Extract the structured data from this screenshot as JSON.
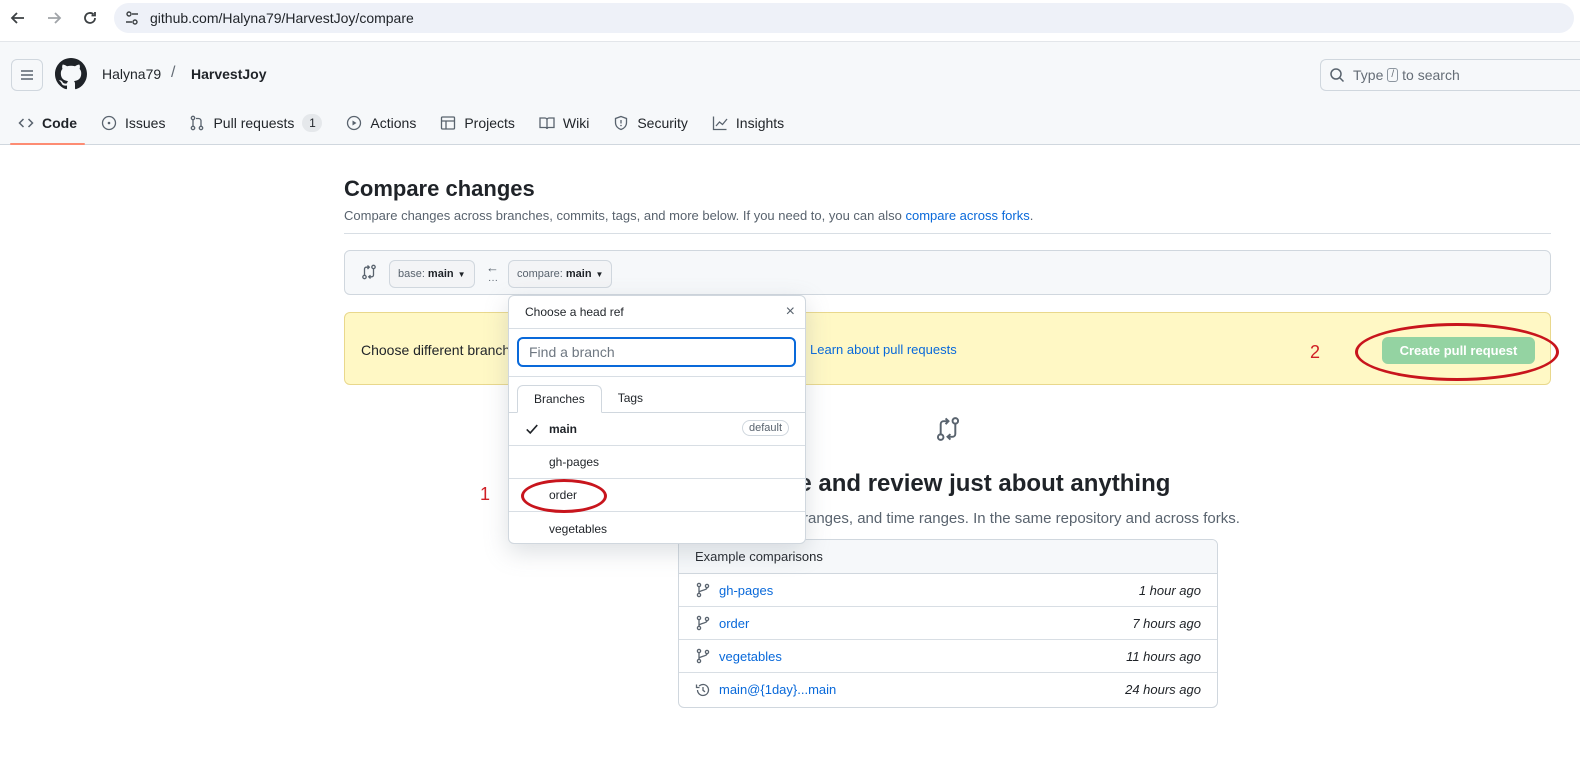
{
  "browser": {
    "url": "github.com/Halyna79/HarvestJoy/compare"
  },
  "header": {
    "owner": "Halyna79",
    "separator": "/",
    "repo": "HarvestJoy",
    "search": {
      "prefix": "Type",
      "key": "/",
      "suffix": "to search"
    },
    "tabs": [
      {
        "label": "Code",
        "icon": "code-icon",
        "active": true
      },
      {
        "label": "Issues",
        "icon": "issue-icon"
      },
      {
        "label": "Pull requests",
        "icon": "pull-request-icon",
        "count": "1"
      },
      {
        "label": "Actions",
        "icon": "play-icon"
      },
      {
        "label": "Projects",
        "icon": "table-icon"
      },
      {
        "label": "Wiki",
        "icon": "book-icon"
      },
      {
        "label": "Security",
        "icon": "shield-icon"
      },
      {
        "label": "Insights",
        "icon": "graph-icon"
      }
    ]
  },
  "compare": {
    "title": "Compare changes",
    "subtitle": "Compare changes across branches, commits, tags, and more below. If you need to, you can also",
    "subtitle_link": "compare across forks",
    "subtitle_end": ".",
    "base": {
      "prefix": "base:",
      "value": "main"
    },
    "head": {
      "prefix": "compare:",
      "value": "main"
    },
    "flash_message": "Choose different branch",
    "learn_link": "Learn about pull requests",
    "create_button": "Create pull request",
    "blank_heading": "re and review just about anything",
    "blank_sub": "ranges, and time ranges. In the same repository and across forks.",
    "examples_title": "Example comparisons",
    "examples": [
      {
        "name": "gh-pages",
        "time": "1 hour ago",
        "icon": "branch-icon"
      },
      {
        "name": "order",
        "time": "7 hours ago",
        "icon": "branch-icon"
      },
      {
        "name": "vegetables",
        "time": "11 hours ago",
        "icon": "branch-icon"
      },
      {
        "name": "main@{1day}...main",
        "time": "24 hours ago",
        "icon": "history-icon"
      }
    ]
  },
  "dropdown": {
    "title": "Choose a head ref",
    "close": "×",
    "filter_placeholder": "Find a branch",
    "tabs": [
      "Branches",
      "Tags"
    ],
    "branches": [
      {
        "name": "main",
        "badge": "default",
        "current": true
      },
      {
        "name": "gh-pages"
      },
      {
        "name": "order"
      },
      {
        "name": "vegetables"
      }
    ]
  },
  "annotations": {
    "one": "1",
    "two": "2",
    "color": "#d01f25"
  }
}
